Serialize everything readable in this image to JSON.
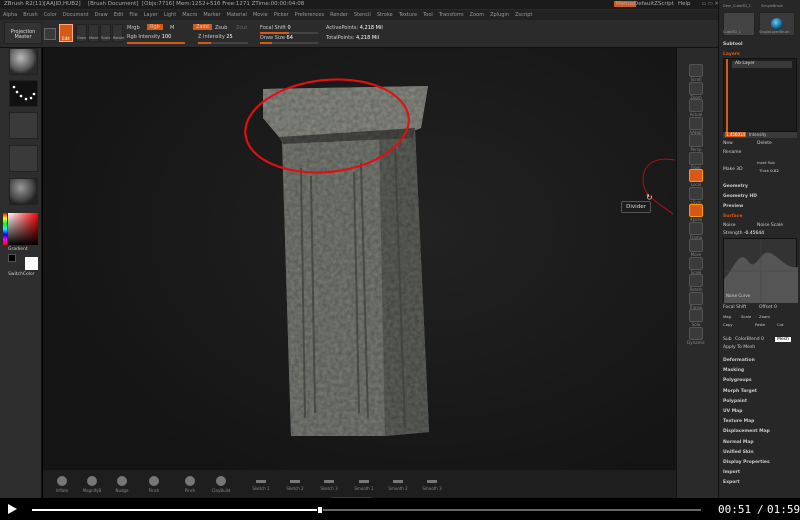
{
  "titlebar": {
    "app": "ZBrush R2(11)[AAJID,HUB2]",
    "document": "[Brush Document]",
    "stats": "[Objs:7716] Mem:1252+516 Free:1271 ZTime:00:00:04:08",
    "menu_btn": "Menus",
    "script": "DefaultZScript",
    "help": "Help"
  },
  "menu": [
    "Alpha",
    "Brush",
    "Color",
    "Document",
    "Draw",
    "Edit",
    "File",
    "Layer",
    "Light",
    "Macro",
    "Marker",
    "Material",
    "Movie",
    "Picker",
    "Preferences",
    "Render",
    "Stencil",
    "Stroke",
    "Texture",
    "Tool",
    "Transform",
    "Zoom",
    "Zplugin",
    "Zscript"
  ],
  "toolbar": {
    "projection_master": "Projection Master",
    "buttons": [
      "Edit",
      "Draw",
      "Move",
      "Scale",
      "Rotate"
    ],
    "mrgb": "Mrgb",
    "rgb": "Rgb",
    "m": "M",
    "zadd": "Zadd",
    "zsub": "Zsub",
    "zcut": "Zcut",
    "rgb_intensity_label": "Rgb Intensity",
    "rgb_intensity": "100",
    "z_intensity_label": "Z Intensity",
    "z_intensity": "25",
    "focal_shift_label": "Focal Shift",
    "focal_shift": "0",
    "draw_size_label": "Draw Size",
    "draw_size": "64",
    "active_points_label": "ActivePoints:",
    "active_points": "4,218 Mil",
    "total_points_label": "TotalPoints:",
    "total_points": "4,218 Mil"
  },
  "left_panel": {
    "gradient": "Gradient",
    "switch_color": "SwitchColor"
  },
  "shelf": [
    "Scroll",
    "Zoom",
    "Actual",
    "AAHalf",
    "Persp",
    "Floor",
    "Local",
    "LSym",
    "Xpose",
    "Frame",
    "Move",
    "Scale",
    "Rotate",
    "Transp",
    "Solo",
    "Dynamic"
  ],
  "tooltip": "Divider",
  "right_tray": {
    "thumb1_label": "Dem_Cube3D_1",
    "thumb2_label": "SimpleBrush",
    "thumb3_label": "Cube3D_1",
    "thumb4_label": "SingleLayerBrush",
    "subtool": "Subtool",
    "layers": "Layers",
    "layer_name": "Ab Layer",
    "intensity_label": "Intensity",
    "intensity_value": "1.456014",
    "new": "New",
    "delete": "Delete",
    "rename": "Rename",
    "make_3d": "Make 3D",
    "inset": "Inset",
    "sub_label": "Sub",
    "thick": "Thick",
    "thick_value": "0.02",
    "geometry": "Geometry",
    "geometry_hd": "Geometry HD",
    "preview": "Preview",
    "surface": "Surface",
    "noise": "Noise",
    "noise_scale": "Noise Scale",
    "strength_label": "Strength",
    "strength_value": "-0.45644",
    "noise_curve": "Noise Curve",
    "focal_shift": "Focal Shift",
    "offset": "Offset",
    "offset_value": "0",
    "mag": "Mag",
    "scale": "Scale",
    "zoom": "Zoom",
    "copy": "Copy",
    "paste": "Paste",
    "cut": "Cut",
    "colorblend": "ColorBlend",
    "colorblend_value": "0",
    "sub2": "Sub",
    "apply_to_mesh": "Apply To Mesh",
    "mesh": "Mesh",
    "menus": [
      "Deformation",
      "Masking",
      "Polygroups",
      "Morph Target",
      "Polypaint",
      "UV Map",
      "Texture Map",
      "Displacement Map",
      "Normal Map",
      "Unified Skin",
      "Display Properties",
      "Import",
      "Export"
    ]
  },
  "brushes": [
    "Inflate",
    "MagnifyB",
    "Nudge",
    "Pinch",
    "Pinch",
    "ClayBuild",
    "Sketch 1",
    "Sketch 2",
    "Sketch 3",
    "Smooth 1",
    "Smooth 2",
    "Smooth 3"
  ],
  "video": {
    "current": "00:51",
    "separator": "/",
    "total": "01:59",
    "progress": 0.43
  },
  "colors": {
    "accent": "#d65a16",
    "annotation_circle": "#e01010"
  }
}
